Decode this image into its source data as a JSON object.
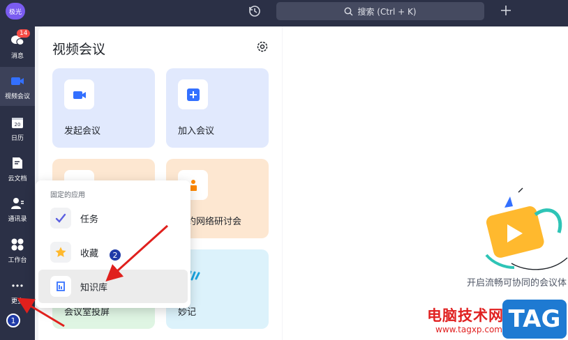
{
  "topbar": {
    "avatar_text": "极光",
    "search_text": "搜索 (Ctrl + K)"
  },
  "sidebar": {
    "items": [
      {
        "label": "消息",
        "badge": "14"
      },
      {
        "label": "视频会议"
      },
      {
        "label": "日历"
      },
      {
        "label": "云文档"
      },
      {
        "label": "通讯录"
      },
      {
        "label": "工作台"
      },
      {
        "label": "更多"
      }
    ],
    "annotation": "1"
  },
  "panel": {
    "title": "视频会议",
    "cards": [
      {
        "label": "发起会议"
      },
      {
        "label": "加入会议"
      },
      {
        "label": "预约网络研讨会"
      },
      {
        "label": "会议室投屏"
      },
      {
        "label": "妙记"
      }
    ]
  },
  "popup": {
    "heading": "固定的应用",
    "items": [
      {
        "label": "任务"
      },
      {
        "label": "收藏"
      },
      {
        "label": "知识库"
      }
    ],
    "annotation": "2"
  },
  "right": {
    "text": "开启流畅可协同的会议体"
  },
  "watermark": {
    "title": "电脑技术网",
    "url": "www.tagxp.com",
    "logo": "TAG"
  },
  "colors": {
    "sidebar_bg": "#2b3046",
    "accent_blue": "#3370ff",
    "card_blue": "#e1e9fd",
    "card_orange": "#fde7d1",
    "card_green": "#dff5e3",
    "card_cyan": "#dcf2fb",
    "arrow_red": "#e0201d"
  }
}
